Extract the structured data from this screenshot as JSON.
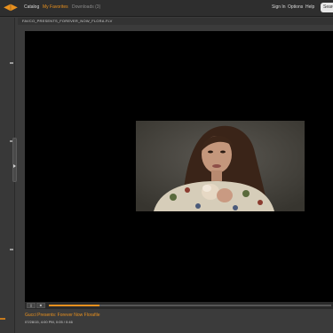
{
  "toolbar": {
    "tabs": [
      "Catalog",
      "My Favorites",
      "Downloads (3)"
    ],
    "sign_in": "Sign In",
    "options": "Options",
    "help": "Help",
    "search_value": "Search",
    "accent_color": "#e8901e"
  },
  "video": {
    "file_title": "FAVCO_PRESENTS_FOREVER_NOW_FLORA.FLV",
    "progress": 0.18
  },
  "caption": {
    "title": "Gucci Presents: Forever Now Florafile",
    "meta": "07/28/15, 4:00 PM, 0:05 / 0:46"
  }
}
